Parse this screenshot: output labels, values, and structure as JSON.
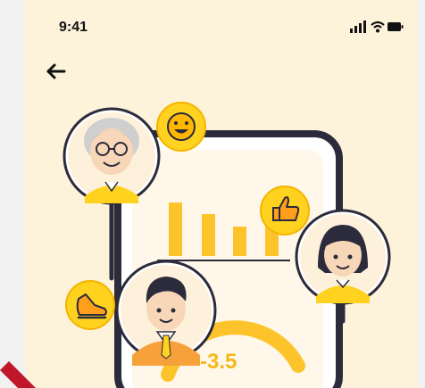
{
  "status_bar": {
    "time": "9:41",
    "icons": [
      "signal-icon",
      "wifi-icon",
      "battery-icon"
    ]
  },
  "nav": {
    "back_icon": "arrow-left-icon"
  },
  "illustration": {
    "metric_value": "-3.5",
    "icons": [
      "smile-icon",
      "thumbs-up-icon",
      "sneaker-icon"
    ],
    "avatars": [
      "avatar-grandmother",
      "avatar-girl",
      "avatar-man"
    ],
    "colors": {
      "background": "#fdf2da",
      "accent": "#ffd21f",
      "outline": "#2b2b3c",
      "bar": "#fcc42a"
    }
  }
}
